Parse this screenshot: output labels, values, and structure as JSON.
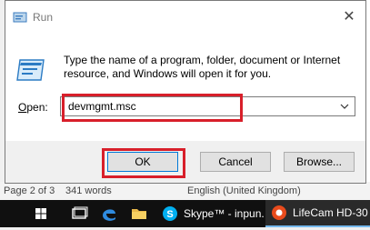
{
  "word_status": {
    "page": "Page 2 of 3",
    "words": "341 words",
    "language": "English (United Kingdom)"
  },
  "dialog": {
    "title": "Run",
    "close_glyph": "✕",
    "description": "Type the name of a program, folder, document or Internet resource, and Windows will open it for you.",
    "open_label_prefix": "",
    "open_label_underlined": "O",
    "open_label_rest": "pen:",
    "open_value": "devmgmt.msc",
    "buttons": {
      "ok": "OK",
      "cancel": "Cancel",
      "browse": "Browse..."
    }
  },
  "taskbar": {
    "apps": [
      {
        "label": "Skype™ - inpun..."
      },
      {
        "label": "LifeCam HD-30"
      }
    ]
  },
  "colors": {
    "highlight": "#d81f2a",
    "taskbar": "#101010"
  }
}
